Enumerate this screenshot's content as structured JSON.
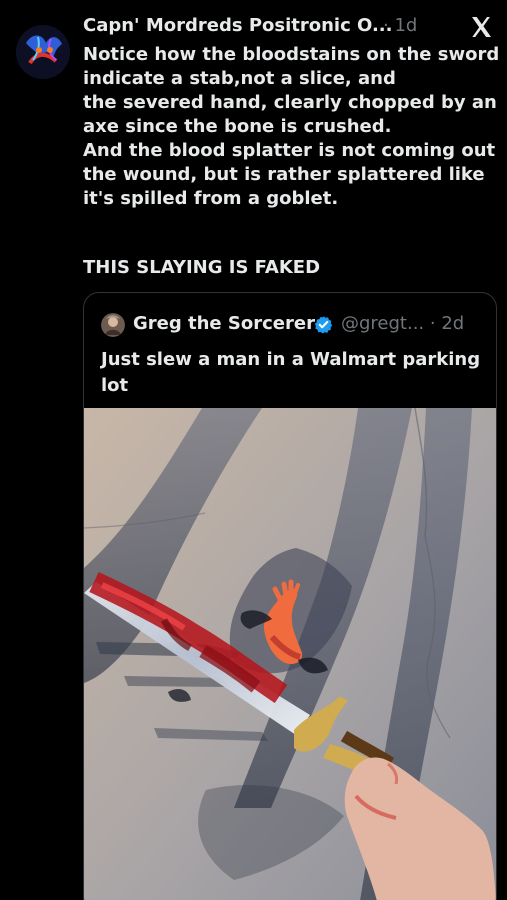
{
  "post": {
    "author": "Capn' Mordreds Positronic O...",
    "time": "· 1d",
    "logo": "x-logo",
    "lines": [
      "Notice how the bloodstains on the sword",
      "indicate a stab,not a slice, and",
      "the severed hand, clearly chopped by an",
      "axe since the bone is crushed.",
      "And the blood splatter is not coming out",
      "the wound, but is rather splattered like",
      "it's spilled from a goblet."
    ],
    "caps_line": "THIS SLAYING IS FAKED"
  },
  "quote": {
    "author": "Greg the Sorcerer",
    "handle_time": "@gregt... · 2d",
    "verified_icon": "verified-badge-icon",
    "lines": [
      "Just slew a man in a Walmart parking",
      "lot"
    ]
  },
  "colors": {
    "background": "#000000",
    "text": "#e7e9ea",
    "muted": "#71767b",
    "verified": "#1d9bf0",
    "border": "#2f3336"
  }
}
